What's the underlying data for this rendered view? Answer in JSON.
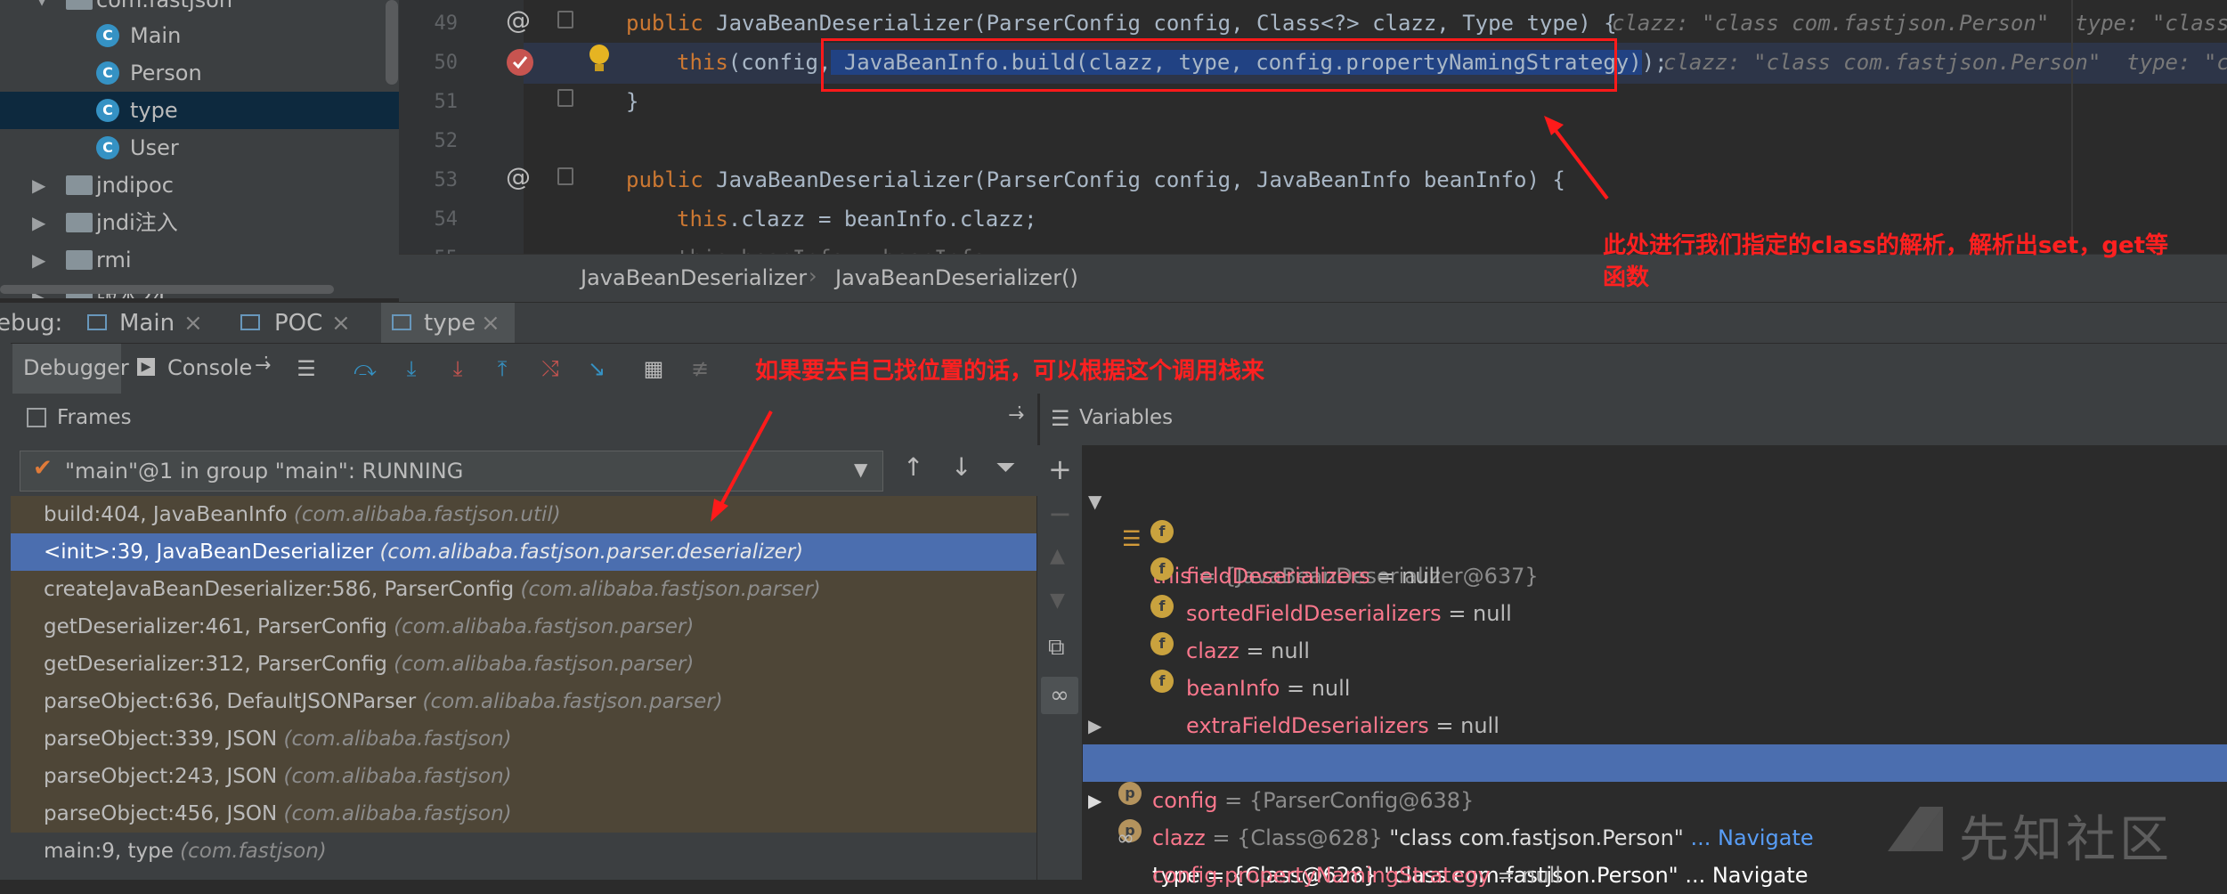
{
  "tree": {
    "items": [
      {
        "label": "com.fastjson",
        "kind": "package"
      },
      {
        "label": "Main",
        "kind": "class"
      },
      {
        "label": "Person",
        "kind": "class"
      },
      {
        "label": "type",
        "kind": "class",
        "selected": true
      },
      {
        "label": "User",
        "kind": "class"
      },
      {
        "label": "jndipoc",
        "kind": "folder"
      },
      {
        "label": "jndi注入",
        "kind": "folder"
      },
      {
        "label": "rmi",
        "kind": "folder"
      },
      {
        "label": "版本24",
        "kind": "folder"
      }
    ]
  },
  "editor": {
    "line_numbers": [
      "49",
      "50",
      "51",
      "52",
      "53",
      "54",
      "55"
    ],
    "l49_kw": "public",
    "l49_text": " JavaBeanDeserializer(ParserConfig config, Class<?> clazz, Type type) {",
    "l49_hint": "clazz: \"class com.fastjson.Person\"  type: \"class c",
    "l50_this": "this",
    "l50_pre": "(config,",
    "l50_call": " JavaBeanInfo.build(clazz, type, config.propertyNamingStrategy)",
    "l50_post": ");",
    "l50_hint": "clazz: \"class com.fastjson.Person\"  type: \"cl",
    "l51": "}",
    "l53_kw": "public",
    "l53_text": " JavaBeanDeserializer(ParserConfig config, JavaBeanInfo beanInfo) {",
    "l54_this": "this",
    "l54_text": ".clazz = beanInfo.clazz;",
    "l55_text": "this.beanInfo = beanInfo;"
  },
  "breadcrumb": {
    "items": [
      "JavaBeanDeserializer",
      "JavaBeanDeserializer()"
    ]
  },
  "debug": {
    "label": "ebug:",
    "tabs": [
      "Main",
      "POC",
      "type"
    ]
  },
  "toolbar": {
    "debugger": "Debugger",
    "console": "Console"
  },
  "frames": {
    "title": "Frames",
    "thread": "\"main\"@1 in group \"main\": RUNNING",
    "rows": [
      {
        "method": "build:404, JavaBeanInfo",
        "pkg": "(com.alibaba.fastjson.util)"
      },
      {
        "method": "<init>:39, JavaBeanDeserializer",
        "pkg": "(com.alibaba.fastjson.parser.deserializer)"
      },
      {
        "method": "createJavaBeanDeserializer:586, ParserConfig",
        "pkg": "(com.alibaba.fastjson.parser)"
      },
      {
        "method": "getDeserializer:461, ParserConfig",
        "pkg": "(com.alibaba.fastjson.parser)"
      },
      {
        "method": "getDeserializer:312, ParserConfig",
        "pkg": "(com.alibaba.fastjson.parser)"
      },
      {
        "method": "parseObject:636, DefaultJSONParser",
        "pkg": "(com.alibaba.fastjson.parser)"
      },
      {
        "method": "parseObject:339, JSON",
        "pkg": "(com.alibaba.fastjson)"
      },
      {
        "method": "parseObject:243, JSON",
        "pkg": "(com.alibaba.fastjson)"
      },
      {
        "method": "parseObject:456, JSON",
        "pkg": "(com.alibaba.fastjson)"
      },
      {
        "method": "main:9, type",
        "pkg": "(com.fastjson)"
      }
    ]
  },
  "variables": {
    "title": "Variables",
    "this_name": "this",
    "this_val": " = {JavaBeanDeserializer@637}",
    "fields": [
      {
        "name": "fieldDeserializers",
        "val": " = null"
      },
      {
        "name": "sortedFieldDeserializers",
        "val": " = null"
      },
      {
        "name": "clazz",
        "val": " = null"
      },
      {
        "name": "beanInfo",
        "val": " = null"
      },
      {
        "name": "extraFieldDeserializers",
        "val": " = null"
      }
    ],
    "config_name": "config",
    "config_val": " = {ParserConfig@638}",
    "clazz_name": "clazz",
    "clazz_ref": " = {Class@628}",
    "clazz_str": " \"class com.fastjson.Person\"",
    "clazz_nav": " ... Navigate",
    "type_name": "type",
    "type_ref": " = {Class@628}",
    "type_str": " \"class com.fastjson.Person\"",
    "type_nav": " ... Navigate",
    "watch_name": "config.propertyNamingStrategy",
    "watch_val": " = null"
  },
  "annotations": {
    "right_line1": "此处进行我们指定的class的解析，解析出set，get等",
    "right_line2": "函数",
    "middle": "如果要去自己找位置的话，可以根据这个调用栈来"
  },
  "watermark": {
    "text": "先知社区"
  }
}
